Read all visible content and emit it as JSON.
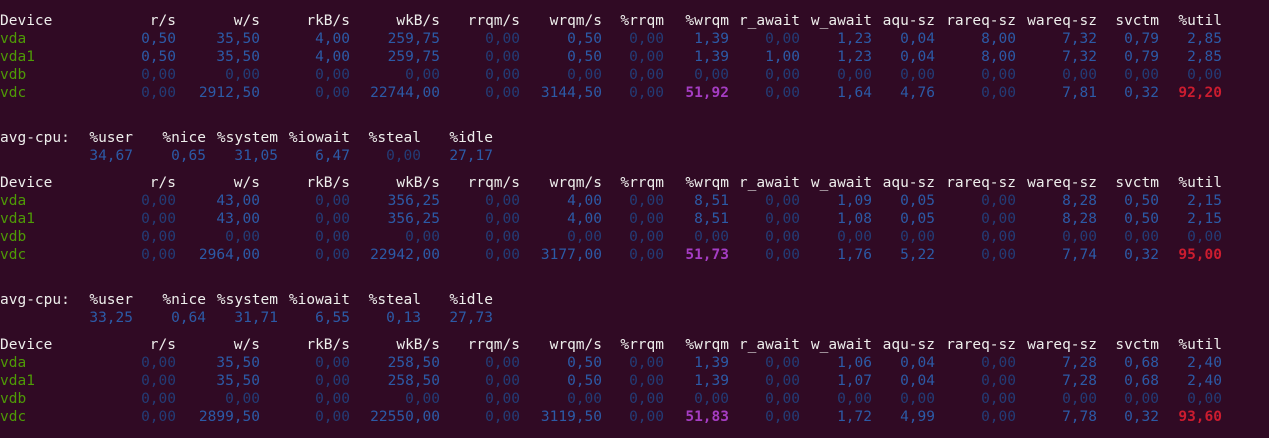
{
  "terminal": {
    "device_header": [
      "Device",
      "r/s",
      "w/s",
      "rkB/s",
      "wkB/s",
      "rrqm/s",
      "wrqm/s",
      "%rrqm",
      "%wrqm",
      "r_await",
      "w_await",
      "aqu-sz",
      "rareq-sz",
      "wareq-sz",
      "svctm",
      "%util"
    ],
    "cpu_header": [
      "avg-cpu:",
      "%user",
      "%nice",
      "%system",
      "%iowait",
      "%steal",
      "%idle"
    ],
    "blocks": [
      {
        "devices": [
          {
            "name": "vda",
            "values": [
              "0,50",
              "35,50",
              "4,00",
              "259,75",
              "0,00",
              "0,50",
              "0,00",
              "1,39",
              "0,00",
              "1,23",
              "0,04",
              "8,00",
              "7,32",
              "0,79",
              "2,85"
            ]
          },
          {
            "name": "vda1",
            "values": [
              "0,50",
              "35,50",
              "4,00",
              "259,75",
              "0,00",
              "0,50",
              "0,00",
              "1,39",
              "1,00",
              "1,23",
              "0,04",
              "8,00",
              "7,32",
              "0,79",
              "2,85"
            ]
          },
          {
            "name": "vdb",
            "values": [
              "0,00",
              "0,00",
              "0,00",
              "0,00",
              "0,00",
              "0,00",
              "0,00",
              "0,00",
              "0,00",
              "0,00",
              "0,00",
              "0,00",
              "0,00",
              "0,00",
              "0,00"
            ]
          },
          {
            "name": "vdc",
            "values": [
              "0,00",
              "2912,50",
              "0,00",
              "22744,00",
              "0,00",
              "3144,50",
              "0,00",
              "51,92",
              "0,00",
              "1,64",
              "4,76",
              "0,00",
              "7,81",
              "0,32",
              "92,20"
            ]
          }
        ],
        "cpu": [
          "34,67",
          "0,65",
          "31,05",
          "6,47",
          "0,00",
          "27,17"
        ]
      },
      {
        "devices": [
          {
            "name": "vda",
            "values": [
              "0,00",
              "43,00",
              "0,00",
              "356,25",
              "0,00",
              "4,00",
              "0,00",
              "8,51",
              "0,00",
              "1,09",
              "0,05",
              "0,00",
              "8,28",
              "0,50",
              "2,15"
            ]
          },
          {
            "name": "vda1",
            "values": [
              "0,00",
              "43,00",
              "0,00",
              "356,25",
              "0,00",
              "4,00",
              "0,00",
              "8,51",
              "0,00",
              "1,08",
              "0,05",
              "0,00",
              "8,28",
              "0,50",
              "2,15"
            ]
          },
          {
            "name": "vdb",
            "values": [
              "0,00",
              "0,00",
              "0,00",
              "0,00",
              "0,00",
              "0,00",
              "0,00",
              "0,00",
              "0,00",
              "0,00",
              "0,00",
              "0,00",
              "0,00",
              "0,00",
              "0,00"
            ]
          },
          {
            "name": "vdc",
            "values": [
              "0,00",
              "2964,00",
              "0,00",
              "22942,00",
              "0,00",
              "3177,00",
              "0,00",
              "51,73",
              "0,00",
              "1,76",
              "5,22",
              "0,00",
              "7,74",
              "0,32",
              "95,00"
            ]
          }
        ],
        "cpu": [
          "33,25",
          "0,64",
          "31,71",
          "6,55",
          "0,13",
          "27,73"
        ]
      },
      {
        "devices": [
          {
            "name": "vda",
            "values": [
              "0,00",
              "35,50",
              "0,00",
              "258,50",
              "0,00",
              "0,50",
              "0,00",
              "1,39",
              "0,00",
              "1,06",
              "0,04",
              "0,00",
              "7,28",
              "0,68",
              "2,40"
            ]
          },
          {
            "name": "vda1",
            "values": [
              "0,00",
              "35,50",
              "0,00",
              "258,50",
              "0,00",
              "0,50",
              "0,00",
              "1,39",
              "0,00",
              "1,07",
              "0,04",
              "0,00",
              "7,28",
              "0,68",
              "2,40"
            ]
          },
          {
            "name": "vdb",
            "values": [
              "0,00",
              "0,00",
              "0,00",
              "0,00",
              "0,00",
              "0,00",
              "0,00",
              "0,00",
              "0,00",
              "0,00",
              "0,00",
              "0,00",
              "0,00",
              "0,00",
              "0,00"
            ]
          },
          {
            "name": "vdc",
            "values": [
              "0,00",
              "2899,50",
              "0,00",
              "22550,00",
              "0,00",
              "3119,50",
              "0,00",
              "51,83",
              "0,00",
              "1,72",
              "4,99",
              "0,00",
              "7,78",
              "0,32",
              "93,60"
            ]
          }
        ],
        "cpu": null
      }
    ]
  },
  "colors": {
    "background": "#300a24",
    "header_text": "#eeeeec",
    "device_name": "#4e9a06",
    "value": "#2c5aa6",
    "zero_value": "#233c76",
    "wrqm_highlight": "#a53dc3",
    "util_highlight": "#cc1c2f"
  }
}
